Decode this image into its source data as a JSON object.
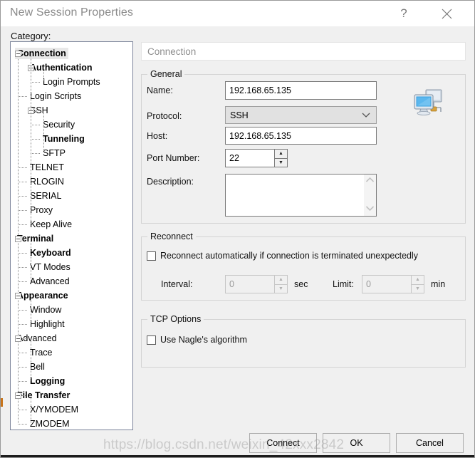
{
  "window": {
    "title": "New Session Properties",
    "help_icon": "question-mark-icon",
    "close_icon": "close-icon"
  },
  "category": {
    "label": "Category:",
    "tree": [
      {
        "label": "Connection",
        "level": 0,
        "bold": true,
        "expander": true,
        "selected": true
      },
      {
        "label": "Authentication",
        "level": 1,
        "bold": true,
        "expander": true,
        "selected": false
      },
      {
        "label": "Login Prompts",
        "level": 2,
        "bold": false,
        "expander": false,
        "selected": false
      },
      {
        "label": "Login Scripts",
        "level": 1,
        "bold": false,
        "expander": false,
        "selected": false
      },
      {
        "label": "SSH",
        "level": 1,
        "bold": false,
        "expander": true,
        "selected": false
      },
      {
        "label": "Security",
        "level": 2,
        "bold": false,
        "expander": false,
        "selected": false
      },
      {
        "label": "Tunneling",
        "level": 2,
        "bold": true,
        "expander": false,
        "selected": false
      },
      {
        "label": "SFTP",
        "level": 2,
        "bold": false,
        "expander": false,
        "selected": false
      },
      {
        "label": "TELNET",
        "level": 1,
        "bold": false,
        "expander": false,
        "selected": false
      },
      {
        "label": "RLOGIN",
        "level": 1,
        "bold": false,
        "expander": false,
        "selected": false
      },
      {
        "label": "SERIAL",
        "level": 1,
        "bold": false,
        "expander": false,
        "selected": false
      },
      {
        "label": "Proxy",
        "level": 1,
        "bold": false,
        "expander": false,
        "selected": false
      },
      {
        "label": "Keep Alive",
        "level": 1,
        "bold": false,
        "expander": false,
        "selected": false
      },
      {
        "label": "Terminal",
        "level": 0,
        "bold": true,
        "expander": true,
        "selected": false
      },
      {
        "label": "Keyboard",
        "level": 1,
        "bold": true,
        "expander": false,
        "selected": false
      },
      {
        "label": "VT Modes",
        "level": 1,
        "bold": false,
        "expander": false,
        "selected": false
      },
      {
        "label": "Advanced",
        "level": 1,
        "bold": false,
        "expander": false,
        "selected": false
      },
      {
        "label": "Appearance",
        "level": 0,
        "bold": true,
        "expander": true,
        "selected": false
      },
      {
        "label": "Window",
        "level": 1,
        "bold": false,
        "expander": false,
        "selected": false
      },
      {
        "label": "Highlight",
        "level": 1,
        "bold": false,
        "expander": false,
        "selected": false
      },
      {
        "label": "Advanced",
        "level": 0,
        "bold": false,
        "expander": true,
        "selected": false
      },
      {
        "label": "Trace",
        "level": 1,
        "bold": false,
        "expander": false,
        "selected": false
      },
      {
        "label": "Bell",
        "level": 1,
        "bold": false,
        "expander": false,
        "selected": false
      },
      {
        "label": "Logging",
        "level": 1,
        "bold": true,
        "expander": false,
        "selected": false
      },
      {
        "label": "File Transfer",
        "level": 0,
        "bold": true,
        "expander": true,
        "selected": false
      },
      {
        "label": "X/YMODEM",
        "level": 1,
        "bold": false,
        "expander": false,
        "selected": false
      },
      {
        "label": "ZMODEM",
        "level": 1,
        "bold": false,
        "expander": false,
        "selected": false
      }
    ]
  },
  "pane": {
    "header": "Connection",
    "general": {
      "title": "General",
      "name_label": "Name:",
      "name_value": "192.168.65.135",
      "protocol_label": "Protocol:",
      "protocol_value": "SSH",
      "protocol_options": [
        "SSH"
      ],
      "host_label": "Host:",
      "host_value": "192.168.65.135",
      "port_label": "Port Number:",
      "port_value": "22",
      "description_label": "Description:",
      "description_value": "",
      "icon": "network-computers-icon"
    },
    "reconnect": {
      "title": "Reconnect",
      "auto_label": "Reconnect automatically if connection is terminated unexpectedly",
      "auto_checked": false,
      "interval_label": "Interval:",
      "interval_value": "0",
      "interval_unit": "sec",
      "limit_label": "Limit:",
      "limit_value": "0",
      "limit_unit": "min"
    },
    "tcp": {
      "title": "TCP Options",
      "nagle_label": "Use Nagle's algorithm",
      "nagle_checked": false
    }
  },
  "footer": {
    "connect": "Connect",
    "ok": "OK",
    "cancel": "Cancel"
  },
  "watermark": "https://blog.csdn.net/weixin_42xxx2842",
  "colors": {
    "window_bg": "#f0f0f0",
    "titlebar_bg": "#ffffff",
    "title_text": "#8a8a8a",
    "tree_border": "#7c849a",
    "field_border": "#7a7a7a",
    "group_border": "#d4d4d4",
    "combo_bg": "#e1e1e1",
    "selection_bg": "#e8e8e8",
    "button_bg": "#f0f0f0"
  }
}
